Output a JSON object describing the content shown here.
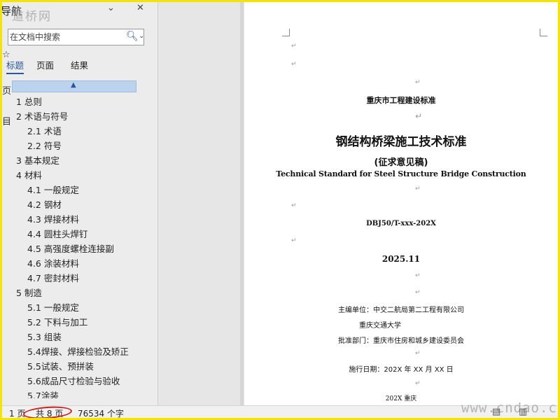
{
  "nav": {
    "title": "导航",
    "watermark": "道桥网",
    "search": {
      "placeholder": "在文档中搜索"
    },
    "tabs": [
      {
        "label": "标题",
        "active": true
      },
      {
        "label": "页面"
      },
      {
        "label": "结果"
      }
    ],
    "headings": [
      {
        "label": "1 总则",
        "level": 1
      },
      {
        "label": "2 术语与符号",
        "level": 1
      },
      {
        "label": "2.1 术语",
        "level": 2
      },
      {
        "label": "2.2 符号",
        "level": 2
      },
      {
        "label": "3 基本规定",
        "level": 1
      },
      {
        "label": "4 材料",
        "level": 1
      },
      {
        "label": "4.1 一般规定",
        "level": 2
      },
      {
        "label": "4.2 钢材",
        "level": 2
      },
      {
        "label": "4.3 焊接材料",
        "level": 2
      },
      {
        "label": "4.4 圆柱头焊钉",
        "level": 2
      },
      {
        "label": "4.5 高强度螺栓连接副",
        "level": 2
      },
      {
        "label": "4.6 涂装材料",
        "level": 2
      },
      {
        "label": "4.7 密封材料",
        "level": 2
      },
      {
        "label": "5 制造",
        "level": 1
      },
      {
        "label": "5.1 一般规定",
        "level": 2
      },
      {
        "label": "5.2 下料与加工",
        "level": 2
      },
      {
        "label": "5.3 组装",
        "level": 2
      },
      {
        "label": "5.4焊接、焊接检验及矫正",
        "level": 2
      },
      {
        "label": "5.5试装、预拼装",
        "level": 2
      },
      {
        "label": "5.6成品尺寸检验与验收",
        "level": 2
      },
      {
        "label": "5.7涂装",
        "level": 2
      }
    ],
    "left_strip": [
      "文",
      "页",
      "目"
    ]
  },
  "doc": {
    "header": "重庆市工程建设标准",
    "title": "钢结构桥梁施工技术标准",
    "subtitle": "(征求意见稿)",
    "english_title": "Technical Standard for Steel Structure Bridge Construction",
    "code": "DBJ50/T-xxx-202X",
    "date": "2025.11",
    "editor_label": "主编单位：",
    "editor_1": "中交二航局第二工程有限公司",
    "editor_2": "重庆交通大学",
    "approver_label": "批准部门：",
    "approver": "重庆市住房和城乡建设委员会",
    "effective_label": "施行日期：",
    "effective": "202X 年 XX 月 XX 日",
    "footer": "202X 重庆",
    "para_mark": "↵"
  },
  "status": {
    "page_prefix": "1 页",
    "total_pages": "共 8 页",
    "word_count": "76534 个字",
    "watermark": "www.cndao.com"
  },
  "colors": {
    "accent": "#2b579a",
    "annotation_ring": "#d21f1f",
    "frame_border": "#f5e400"
  }
}
